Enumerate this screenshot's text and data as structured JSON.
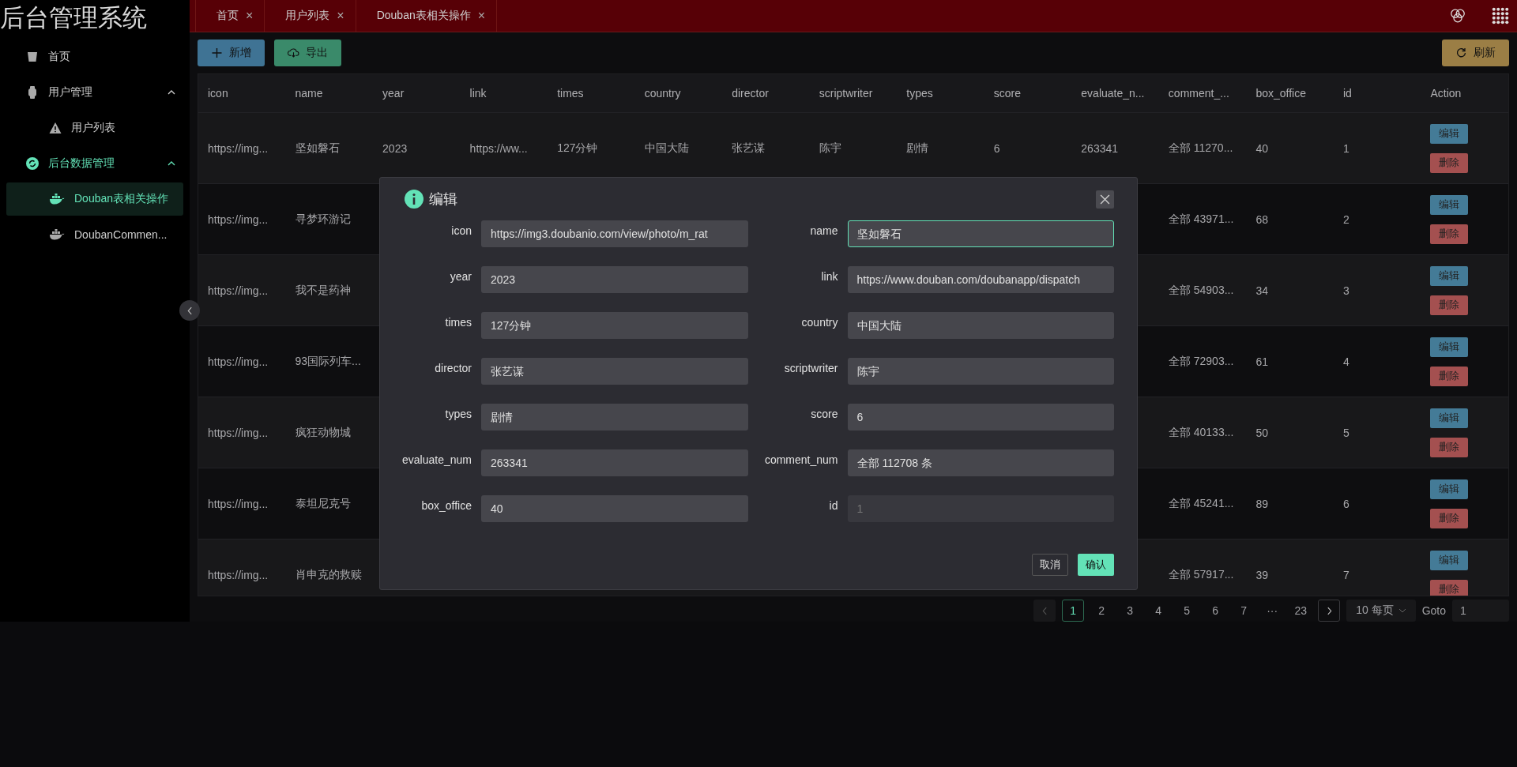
{
  "sidebar": {
    "title": "后台管理系统",
    "items": [
      {
        "label": "首页",
        "selected": false
      },
      {
        "label": "用户管理",
        "selected": false,
        "expanded": true,
        "children": [
          {
            "label": "用户列表",
            "selected": false
          }
        ]
      },
      {
        "label": "后台数据管理",
        "selected": true,
        "expanded": true,
        "children": [
          {
            "label": "Douban表相关操作",
            "selected": true
          },
          {
            "label": "DoubanCommen...",
            "selected": false
          }
        ]
      }
    ]
  },
  "tabs": [
    {
      "label": "首页",
      "close": "×"
    },
    {
      "label": "用户列表",
      "close": "×"
    },
    {
      "label": "Douban表相关操作",
      "close": "×"
    }
  ],
  "toolbar": {
    "buttons": [
      {
        "label": "新增",
        "kind": "add"
      },
      {
        "label": "导出",
        "kind": "export"
      }
    ],
    "refresh": "刷新"
  },
  "table": {
    "columns": [
      "icon",
      "name",
      "year",
      "link",
      "times",
      "country",
      "director",
      "scriptwriter",
      "types",
      "score",
      "evaluate_n...",
      "comment_...",
      "box_office",
      "id",
      "Action"
    ],
    "rows": [
      {
        "cells": [
          "https://img...",
          "坚如磐石",
          "2023",
          "https://ww...",
          "127分钟",
          "中国大陆",
          "张艺谋",
          "陈宇",
          "剧情",
          "6",
          "263341",
          "全部 11270...",
          "40",
          "1"
        ],
        "actions": [
          "编辑",
          "删除"
        ]
      },
      {
        "cells": [
          "https://img...",
          "寻梦环游记",
          null,
          null,
          null,
          null,
          null,
          null,
          null,
          null,
          null,
          "全部 43971...",
          "68",
          "2"
        ],
        "actions": [
          "编辑",
          "删除"
        ]
      },
      {
        "cells": [
          "https://img...",
          "我不是药神",
          null,
          null,
          null,
          null,
          null,
          null,
          null,
          null,
          null,
          "全部 54903...",
          "34",
          "3"
        ],
        "actions": [
          "编辑",
          "删除"
        ]
      },
      {
        "cells": [
          "https://img...",
          "93国际列车...",
          null,
          null,
          null,
          null,
          null,
          null,
          null,
          null,
          null,
          "全部 72903...",
          "61",
          "4"
        ],
        "actions": [
          "编辑",
          "删除"
        ]
      },
      {
        "cells": [
          "https://img...",
          "疯狂动物城",
          null,
          null,
          null,
          null,
          null,
          null,
          null,
          null,
          null,
          "全部 40133...",
          "50",
          "5"
        ],
        "actions": [
          "编辑",
          "删除"
        ]
      },
      {
        "cells": [
          "https://img...",
          "泰坦尼克号",
          null,
          null,
          null,
          null,
          null,
          null,
          null,
          null,
          null,
          "全部 45241...",
          "89",
          "6"
        ],
        "actions": [
          "编辑",
          "删除"
        ]
      },
      {
        "cells": [
          "https://img...",
          "肖申克的救赎",
          null,
          null,
          null,
          null,
          null,
          null,
          null,
          null,
          null,
          "全部 57917...",
          "39",
          "7"
        ],
        "actions": [
          "编辑",
          "删除"
        ]
      }
    ]
  },
  "pagination": {
    "prev_disabled": true,
    "pages": [
      {
        "label": "1",
        "selected": true
      },
      {
        "label": "2",
        "selected": false
      },
      {
        "label": "3",
        "selected": false
      },
      {
        "label": "4",
        "selected": false
      },
      {
        "label": "5",
        "selected": false
      },
      {
        "label": "6",
        "selected": false
      },
      {
        "label": "7",
        "selected": false
      },
      {
        "label": "···",
        "selected": false
      },
      {
        "label": "23",
        "selected": false
      }
    ],
    "page_size": "10 每页",
    "goto_label": "Goto",
    "goto_value": "1"
  },
  "dialog": {
    "title": "编辑",
    "fields": [
      {
        "label": "icon",
        "value": "https://img3.doubanio.com/view/photo/m_rat",
        "focused": false,
        "disabled": false
      },
      {
        "label": "name",
        "value": "坚如磐石",
        "focused": true,
        "disabled": false
      },
      {
        "label": "year",
        "value": "2023",
        "focused": false,
        "disabled": false
      },
      {
        "label": "link",
        "value": "https://www.douban.com/doubanapp/dispatch",
        "focused": false,
        "disabled": false
      },
      {
        "label": "times",
        "value": "127分钟",
        "focused": false,
        "disabled": false
      },
      {
        "label": "country",
        "value": "中国大陆",
        "focused": false,
        "disabled": false
      },
      {
        "label": "director",
        "value": "张艺谋",
        "focused": false,
        "disabled": false
      },
      {
        "label": "scriptwriter",
        "value": "陈宇",
        "focused": false,
        "disabled": false
      },
      {
        "label": "types",
        "value": "剧情",
        "focused": false,
        "disabled": false
      },
      {
        "label": "score",
        "value": "6",
        "focused": false,
        "disabled": false
      },
      {
        "label": "evaluate_num",
        "value": "263341",
        "focused": false,
        "disabled": false
      },
      {
        "label": "comment_num",
        "value": "全部 112708 条",
        "focused": false,
        "disabled": false
      },
      {
        "label": "box_office",
        "value": "40",
        "focused": false,
        "disabled": false
      },
      {
        "label": "id",
        "value": "1",
        "focused": false,
        "disabled": true
      }
    ],
    "cancel": "取消",
    "confirm": "确认"
  }
}
